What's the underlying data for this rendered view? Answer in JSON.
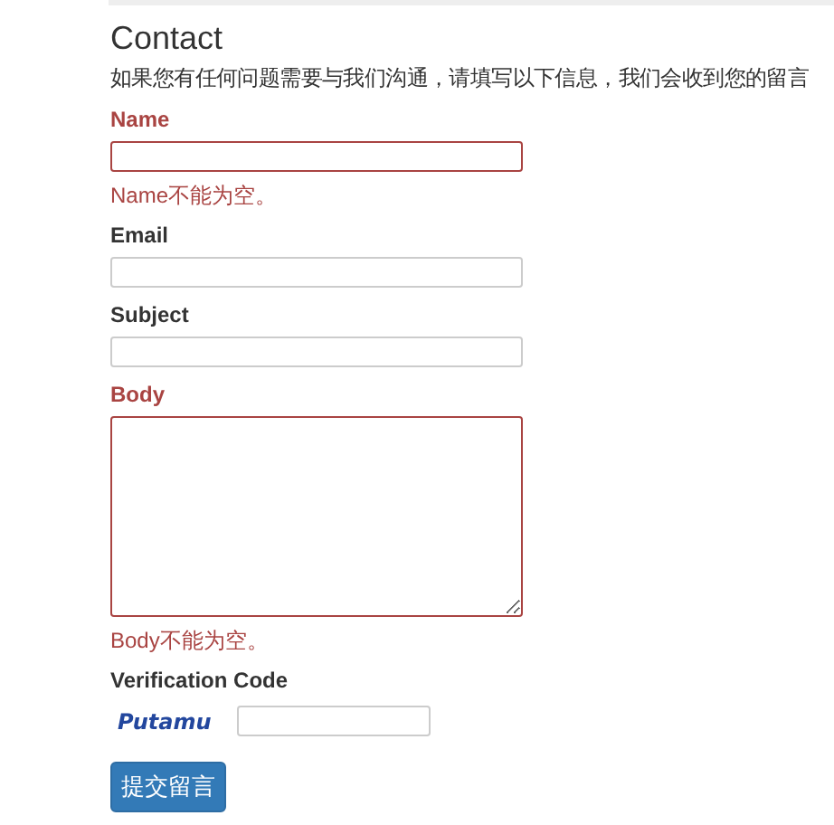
{
  "title": "Contact",
  "intro": "如果您有任何问题需要与我们沟通，请填写以下信息，我们会收到您的留言",
  "fields": [
    {
      "label": "Name",
      "kind": "input",
      "invalid": true,
      "error": "Name不能为空。"
    },
    {
      "label": "Email",
      "kind": "input",
      "invalid": false
    },
    {
      "label": "Subject",
      "kind": "input",
      "invalid": false
    },
    {
      "label": "Body",
      "kind": "textarea",
      "invalid": true,
      "error": "Body不能为空。"
    }
  ],
  "verification": {
    "label": "Verification Code",
    "captcha": "Putamu"
  },
  "submit": "提交留言"
}
